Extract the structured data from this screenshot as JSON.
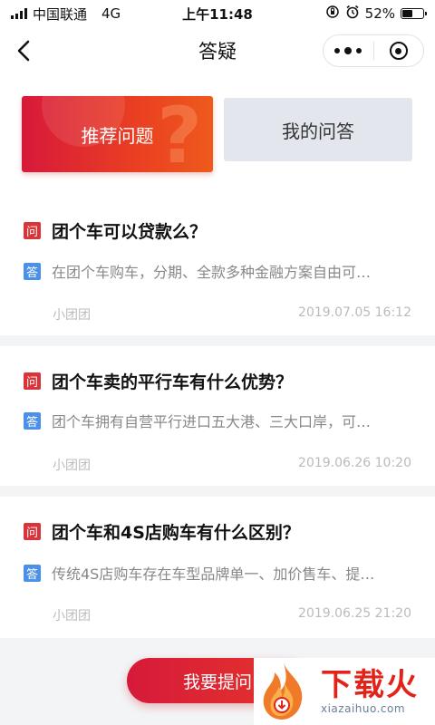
{
  "status_bar": {
    "carrier": "中国联通",
    "network": "4G",
    "time": "上午11:48",
    "battery": "52%",
    "battery_level": 0.52
  },
  "nav": {
    "title": "答疑"
  },
  "tabs": [
    {
      "label": "推荐问题",
      "active": true
    },
    {
      "label": "我的问答",
      "active": false
    }
  ],
  "questions": [
    {
      "q_badge": "问",
      "question": "团个车可以贷款么？",
      "a_badge": "答",
      "answer": "在团个车购车，分期、全款多种金融方案自由可…",
      "author": "小团团",
      "date": "2019.07.05 16:12"
    },
    {
      "q_badge": "问",
      "question": "团个车卖的平行车有什么优势？",
      "a_badge": "答",
      "answer": "团个车拥有自营平行进口五大港、三大口岸，可…",
      "author": "小团团",
      "date": "2019.06.26 10:20"
    },
    {
      "q_badge": "问",
      "question": "团个车和4S店购车有什么区别？",
      "a_badge": "答",
      "answer": "传统4S店购车存在车型品牌单一、加价售车、提…",
      "author": "小团团",
      "date": "2019.06.25 21:20"
    }
  ],
  "ask_button": "我要提问",
  "watermark": {
    "title": "下载火",
    "url": "xiazaihuo.com"
  },
  "colors": {
    "accent": "#e2231a",
    "question_badge": "#d9343a",
    "answer_badge": "#4a90e8"
  }
}
